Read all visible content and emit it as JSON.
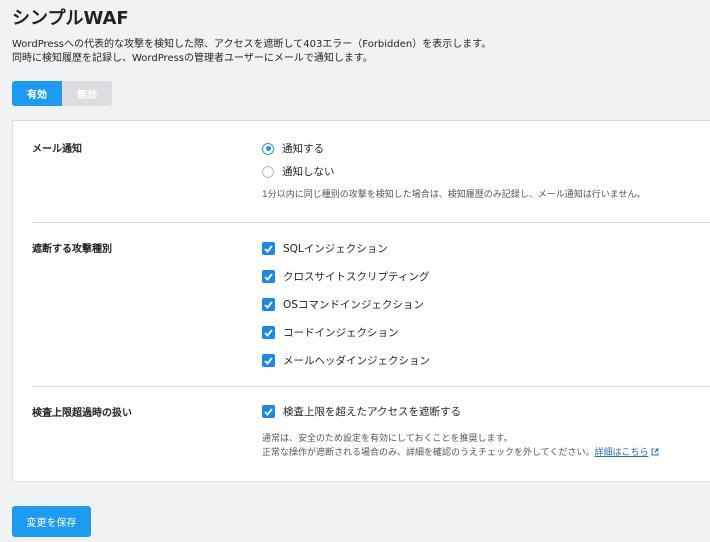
{
  "page": {
    "title": "シンプルWAF",
    "description_line1": "WordPressへの代表的な攻撃を検知した際、アクセスを遮断して403エラー（Forbidden）を表示します。",
    "description_line2": "同時に検知履歴を記録し、WordPressの管理者ユーザーにメールで通知します。"
  },
  "toggle": {
    "on_label": "有効",
    "off_label": "無効",
    "selected": "有効"
  },
  "mail_notification": {
    "label": "メール通知",
    "options": [
      {
        "label": "通知する",
        "checked": true
      },
      {
        "label": "通知しない",
        "checked": false
      }
    ],
    "note": "1分以内に同じ種別の攻撃を検知した場合は、検知履歴のみ記録し、メール通知は行いません。"
  },
  "attack_types": {
    "label": "遮断する攻撃種別",
    "items": [
      {
        "label": "SQLインジェクション",
        "checked": true
      },
      {
        "label": "クロスサイトスクリプティング",
        "checked": true
      },
      {
        "label": "OSコマンドインジェクション",
        "checked": true
      },
      {
        "label": "コードインジェクション",
        "checked": true
      },
      {
        "label": "メールヘッダインジェクション",
        "checked": true
      }
    ]
  },
  "limit_handling": {
    "label": "検査上限超過時の扱い",
    "checkbox_label": "検査上限を超えたアクセスを遮断する",
    "checked": true,
    "note_line1": "通常は、安全のため設定を有効にしておくことを推奨します。",
    "note_line2": "正常な操作が遮断される場合のみ、詳細を確認のうえチェックを外してください。",
    "link_text": "詳細はこちら",
    "link_icon": "external-link-icon"
  },
  "save_button": {
    "label": "変更を保存"
  },
  "colors": {
    "accent": "#1e9bf0",
    "checkbox": "#1e88e5",
    "link": "#2271b1",
    "background": "#f1f2f4"
  }
}
